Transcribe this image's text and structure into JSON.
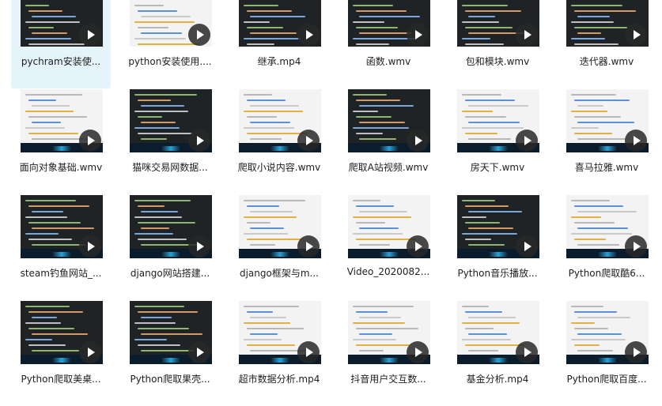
{
  "files": [
    {
      "name": "pychram安装使...",
      "theme": "dark",
      "selected": true
    },
    {
      "name": "python安装使用....",
      "theme": "light"
    },
    {
      "name": "继承.mp4",
      "theme": "dark"
    },
    {
      "name": "函数.wmv",
      "theme": "dark"
    },
    {
      "name": "包和模块.wmv",
      "theme": "dark"
    },
    {
      "name": "迭代器.wmv",
      "theme": "dark"
    },
    {
      "name": "面向对象基础.wmv",
      "theme": "light"
    },
    {
      "name": "猫咪交易网数据...",
      "theme": "dark"
    },
    {
      "name": "爬取小说内容.wmv",
      "theme": "light"
    },
    {
      "name": "爬取A站视频.wmv",
      "theme": "dark"
    },
    {
      "name": "房天下.wmv",
      "theme": "light"
    },
    {
      "name": "喜马拉雅.wmv",
      "theme": "light"
    },
    {
      "name": "steam钓鱼网站_...",
      "theme": "dark"
    },
    {
      "name": "django网站搭建...",
      "theme": "dark"
    },
    {
      "name": "django框架与m...",
      "theme": "light"
    },
    {
      "name": "Video_2020082...",
      "theme": "light"
    },
    {
      "name": "Python音乐播放...",
      "theme": "dark"
    },
    {
      "name": "Python爬取酷6...",
      "theme": "light"
    },
    {
      "name": "Python爬取美桌...",
      "theme": "dark"
    },
    {
      "name": "Python爬取果壳...",
      "theme": "dark"
    },
    {
      "name": "超市数据分析.mp4",
      "theme": "light"
    },
    {
      "name": "抖音用户交互数...",
      "theme": "light"
    },
    {
      "name": "基金分析.mp4",
      "theme": "light"
    },
    {
      "name": "Python爬取百度...",
      "theme": "light"
    }
  ]
}
